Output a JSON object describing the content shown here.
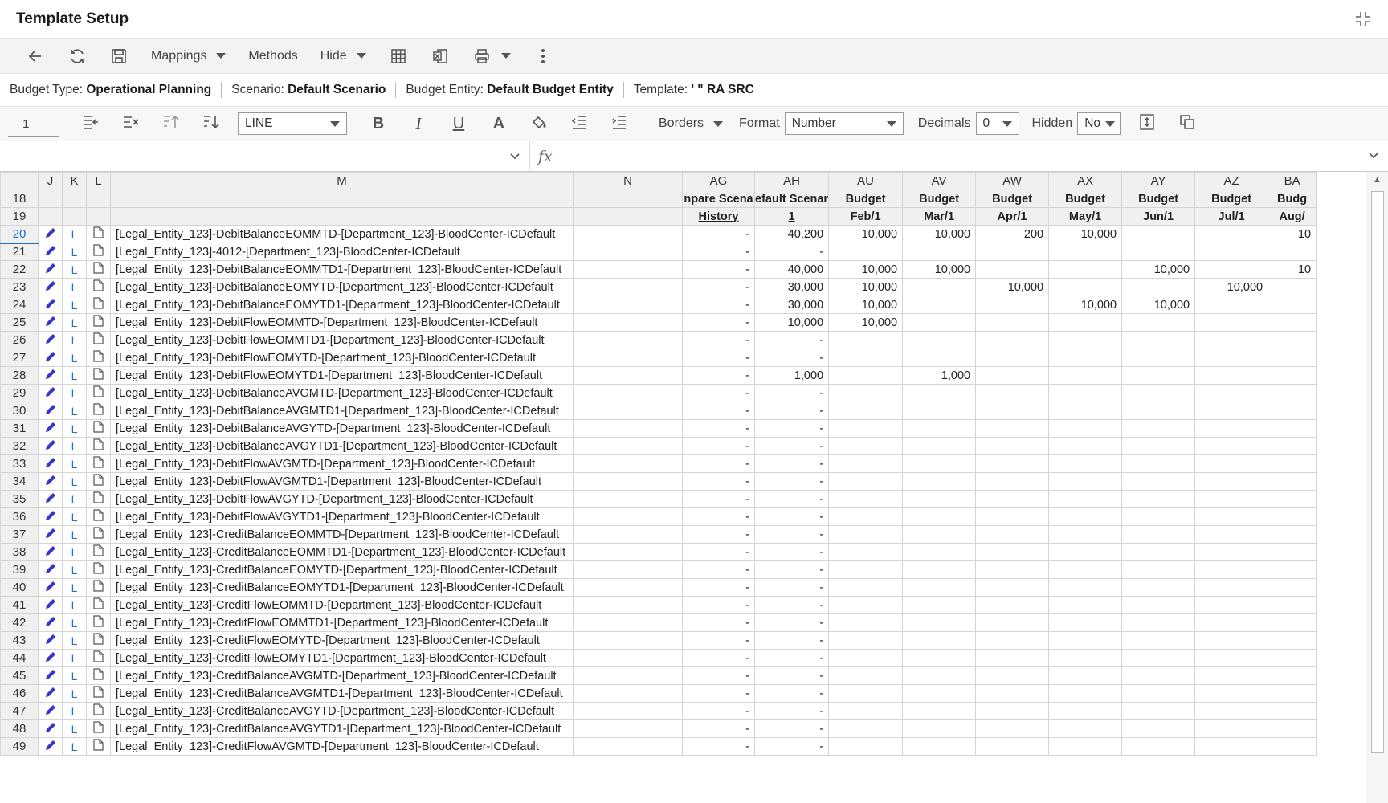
{
  "window": {
    "title": "Template Setup"
  },
  "toolbar": {
    "mappings": "Mappings",
    "methods": "Methods",
    "hide": "Hide"
  },
  "info": {
    "budget_type_label": "Budget Type:",
    "budget_type_value": "Operational Planning",
    "scenario_label": "Scenario:",
    "scenario_value": "Default Scenario",
    "entity_label": "Budget Entity:",
    "entity_value": "Default Budget Entity",
    "template_label": "Template:",
    "template_value": "' \" RA SRC"
  },
  "format": {
    "cell_ref": "1",
    "line_select": "LINE",
    "borders": "Borders",
    "format_label": "Format",
    "format_value": "Number",
    "decimals_label": "Decimals",
    "decimals_value": "0",
    "hidden_label": "Hidden",
    "hidden_value": "No"
  },
  "grid": {
    "columns": [
      "J",
      "K",
      "L",
      "M",
      "N",
      "AG",
      "AH",
      "AU",
      "AV",
      "AW",
      "AX",
      "AY",
      "AZ",
      "BA"
    ],
    "header_rows": [
      {
        "num": "18",
        "cells": [
          "npare Scena",
          "efault Scenar",
          "Budget",
          "Budget",
          "Budget",
          "Budget",
          "Budget",
          "Budget",
          "Budg"
        ]
      },
      {
        "num": "19",
        "cells": [
          "History",
          "1",
          "Feb/1",
          "Mar/1",
          "Apr/1",
          "May/1",
          "Jun/1",
          "Jul/1",
          "Aug/"
        ]
      }
    ],
    "rows": [
      {
        "num": "20",
        "l": "L",
        "account": "[Legal_Entity_123]-DebitBalanceEOMMTD-[Department_123]-BloodCenter-ICDefault",
        "ag": "-",
        "ah": "40,200",
        "au": "10,000",
        "av": "10,000",
        "aw": "200",
        "ax": "10,000",
        "ay": "",
        "az": "",
        "ba": "10"
      },
      {
        "num": "21",
        "l": "L",
        "account": "[Legal_Entity_123]-4012-[Department_123]-BloodCenter-ICDefault",
        "ag": "-",
        "ah": "-",
        "au": "",
        "av": "",
        "aw": "",
        "ax": "",
        "ay": "",
        "az": "",
        "ba": ""
      },
      {
        "num": "22",
        "l": "L",
        "account": "[Legal_Entity_123]-DebitBalanceEOMMTD1-[Department_123]-BloodCenter-ICDefault",
        "ag": "-",
        "ah": "40,000",
        "au": "10,000",
        "av": "10,000",
        "aw": "",
        "ax": "",
        "ay": "10,000",
        "az": "",
        "ba": "10"
      },
      {
        "num": "23",
        "l": "L",
        "account": "[Legal_Entity_123]-DebitBalanceEOMYTD-[Department_123]-BloodCenter-ICDefault",
        "ag": "-",
        "ah": "30,000",
        "au": "10,000",
        "av": "",
        "aw": "10,000",
        "ax": "",
        "ay": "",
        "az": "10,000",
        "ba": ""
      },
      {
        "num": "24",
        "l": "L",
        "account": "[Legal_Entity_123]-DebitBalanceEOMYTD1-[Department_123]-BloodCenter-ICDefault",
        "ag": "-",
        "ah": "30,000",
        "au": "10,000",
        "av": "",
        "aw": "",
        "ax": "10,000",
        "ay": "10,000",
        "az": "",
        "ba": ""
      },
      {
        "num": "25",
        "l": "L",
        "account": "[Legal_Entity_123]-DebitFlowEOMMTD-[Department_123]-BloodCenter-ICDefault",
        "ag": "-",
        "ah": "10,000",
        "au": "10,000",
        "av": "",
        "aw": "",
        "ax": "",
        "ay": "",
        "az": "",
        "ba": ""
      },
      {
        "num": "26",
        "l": "L",
        "account": "[Legal_Entity_123]-DebitFlowEOMMTD1-[Department_123]-BloodCenter-ICDefault",
        "ag": "-",
        "ah": "-",
        "au": "",
        "av": "",
        "aw": "",
        "ax": "",
        "ay": "",
        "az": "",
        "ba": ""
      },
      {
        "num": "27",
        "l": "L",
        "account": "[Legal_Entity_123]-DebitFlowEOMYTD-[Department_123]-BloodCenter-ICDefault",
        "ag": "-",
        "ah": "-",
        "au": "",
        "av": "",
        "aw": "",
        "ax": "",
        "ay": "",
        "az": "",
        "ba": ""
      },
      {
        "num": "28",
        "l": "L",
        "account": "[Legal_Entity_123]-DebitFlowEOMYTD1-[Department_123]-BloodCenter-ICDefault",
        "ag": "-",
        "ah": "1,000",
        "au": "",
        "av": "1,000",
        "aw": "",
        "ax": "",
        "ay": "",
        "az": "",
        "ba": ""
      },
      {
        "num": "29",
        "l": "L",
        "account": "[Legal_Entity_123]-DebitBalanceAVGMTD-[Department_123]-BloodCenter-ICDefault",
        "ag": "-",
        "ah": "-",
        "au": "",
        "av": "",
        "aw": "",
        "ax": "",
        "ay": "",
        "az": "",
        "ba": ""
      },
      {
        "num": "30",
        "l": "L",
        "account": "[Legal_Entity_123]-DebitBalanceAVGMTD1-[Department_123]-BloodCenter-ICDefault",
        "ag": "-",
        "ah": "-",
        "au": "",
        "av": "",
        "aw": "",
        "ax": "",
        "ay": "",
        "az": "",
        "ba": ""
      },
      {
        "num": "31",
        "l": "L",
        "account": "[Legal_Entity_123]-DebitBalanceAVGYTD-[Department_123]-BloodCenter-ICDefault",
        "ag": "-",
        "ah": "-",
        "au": "",
        "av": "",
        "aw": "",
        "ax": "",
        "ay": "",
        "az": "",
        "ba": ""
      },
      {
        "num": "32",
        "l": "L",
        "account": "[Legal_Entity_123]-DebitBalanceAVGYTD1-[Department_123]-BloodCenter-ICDefault",
        "ag": "-",
        "ah": "-",
        "au": "",
        "av": "",
        "aw": "",
        "ax": "",
        "ay": "",
        "az": "",
        "ba": ""
      },
      {
        "num": "33",
        "l": "L",
        "account": "[Legal_Entity_123]-DebitFlowAVGMTD-[Department_123]-BloodCenter-ICDefault",
        "ag": "-",
        "ah": "-",
        "au": "",
        "av": "",
        "aw": "",
        "ax": "",
        "ay": "",
        "az": "",
        "ba": ""
      },
      {
        "num": "34",
        "l": "L",
        "account": "[Legal_Entity_123]-DebitFlowAVGMTD1-[Department_123]-BloodCenter-ICDefault",
        "ag": "-",
        "ah": "-",
        "au": "",
        "av": "",
        "aw": "",
        "ax": "",
        "ay": "",
        "az": "",
        "ba": ""
      },
      {
        "num": "35",
        "l": "L",
        "account": "[Legal_Entity_123]-DebitFlowAVGYTD-[Department_123]-BloodCenter-ICDefault",
        "ag": "-",
        "ah": "-",
        "au": "",
        "av": "",
        "aw": "",
        "ax": "",
        "ay": "",
        "az": "",
        "ba": ""
      },
      {
        "num": "36",
        "l": "L",
        "account": "[Legal_Entity_123]-DebitFlowAVGYTD1-[Department_123]-BloodCenter-ICDefault",
        "ag": "-",
        "ah": "-",
        "au": "",
        "av": "",
        "aw": "",
        "ax": "",
        "ay": "",
        "az": "",
        "ba": ""
      },
      {
        "num": "37",
        "l": "L",
        "account": "[Legal_Entity_123]-CreditBalanceEOMMTD-[Department_123]-BloodCenter-ICDefault",
        "ag": "-",
        "ah": "-",
        "au": "",
        "av": "",
        "aw": "",
        "ax": "",
        "ay": "",
        "az": "",
        "ba": ""
      },
      {
        "num": "38",
        "l": "L",
        "account": "[Legal_Entity_123]-CreditBalanceEOMMTD1-[Department_123]-BloodCenter-ICDefault",
        "ag": "-",
        "ah": "-",
        "au": "",
        "av": "",
        "aw": "",
        "ax": "",
        "ay": "",
        "az": "",
        "ba": ""
      },
      {
        "num": "39",
        "l": "L",
        "account": "[Legal_Entity_123]-CreditBalanceEOMYTD-[Department_123]-BloodCenter-ICDefault",
        "ag": "-",
        "ah": "-",
        "au": "",
        "av": "",
        "aw": "",
        "ax": "",
        "ay": "",
        "az": "",
        "ba": ""
      },
      {
        "num": "40",
        "l": "L",
        "account": "[Legal_Entity_123]-CreditBalanceEOMYTD1-[Department_123]-BloodCenter-ICDefault",
        "ag": "-",
        "ah": "-",
        "au": "",
        "av": "",
        "aw": "",
        "ax": "",
        "ay": "",
        "az": "",
        "ba": ""
      },
      {
        "num": "41",
        "l": "L",
        "account": "[Legal_Entity_123]-CreditFlowEOMMTD-[Department_123]-BloodCenter-ICDefault",
        "ag": "-",
        "ah": "-",
        "au": "",
        "av": "",
        "aw": "",
        "ax": "",
        "ay": "",
        "az": "",
        "ba": ""
      },
      {
        "num": "42",
        "l": "L",
        "account": "[Legal_Entity_123]-CreditFlowEOMMTD1-[Department_123]-BloodCenter-ICDefault",
        "ag": "-",
        "ah": "-",
        "au": "",
        "av": "",
        "aw": "",
        "ax": "",
        "ay": "",
        "az": "",
        "ba": ""
      },
      {
        "num": "43",
        "l": "L",
        "account": "[Legal_Entity_123]-CreditFlowEOMYTD-[Department_123]-BloodCenter-ICDefault",
        "ag": "-",
        "ah": "-",
        "au": "",
        "av": "",
        "aw": "",
        "ax": "",
        "ay": "",
        "az": "",
        "ba": ""
      },
      {
        "num": "44",
        "l": "L",
        "account": "[Legal_Entity_123]-CreditFlowEOMYTD1-[Department_123]-BloodCenter-ICDefault",
        "ag": "-",
        "ah": "-",
        "au": "",
        "av": "",
        "aw": "",
        "ax": "",
        "ay": "",
        "az": "",
        "ba": ""
      },
      {
        "num": "45",
        "l": "L",
        "account": "[Legal_Entity_123]-CreditBalanceAVGMTD-[Department_123]-BloodCenter-ICDefault",
        "ag": "-",
        "ah": "-",
        "au": "",
        "av": "",
        "aw": "",
        "ax": "",
        "ay": "",
        "az": "",
        "ba": ""
      },
      {
        "num": "46",
        "l": "L",
        "account": "[Legal_Entity_123]-CreditBalanceAVGMTD1-[Department_123]-BloodCenter-ICDefault",
        "ag": "-",
        "ah": "-",
        "au": "",
        "av": "",
        "aw": "",
        "ax": "",
        "ay": "",
        "az": "",
        "ba": ""
      },
      {
        "num": "47",
        "l": "L",
        "account": "[Legal_Entity_123]-CreditBalanceAVGYTD-[Department_123]-BloodCenter-ICDefault",
        "ag": "-",
        "ah": "-",
        "au": "",
        "av": "",
        "aw": "",
        "ax": "",
        "ay": "",
        "az": "",
        "ba": ""
      },
      {
        "num": "48",
        "l": "L",
        "account": "[Legal_Entity_123]-CreditBalanceAVGYTD1-[Department_123]-BloodCenter-ICDefault",
        "ag": "-",
        "ah": "-",
        "au": "",
        "av": "",
        "aw": "",
        "ax": "",
        "ay": "",
        "az": "",
        "ba": ""
      },
      {
        "num": "49",
        "l": "L",
        "account": "[Legal_Entity_123]-CreditFlowAVGMTD-[Department_123]-BloodCenter-ICDefault",
        "ag": "-",
        "ah": "-",
        "au": "",
        "av": "",
        "aw": "",
        "ax": "",
        "ay": "",
        "az": "",
        "ba": ""
      }
    ]
  },
  "colors": {
    "accent": "#1f6fd1",
    "pencil": "#3a34c9"
  }
}
